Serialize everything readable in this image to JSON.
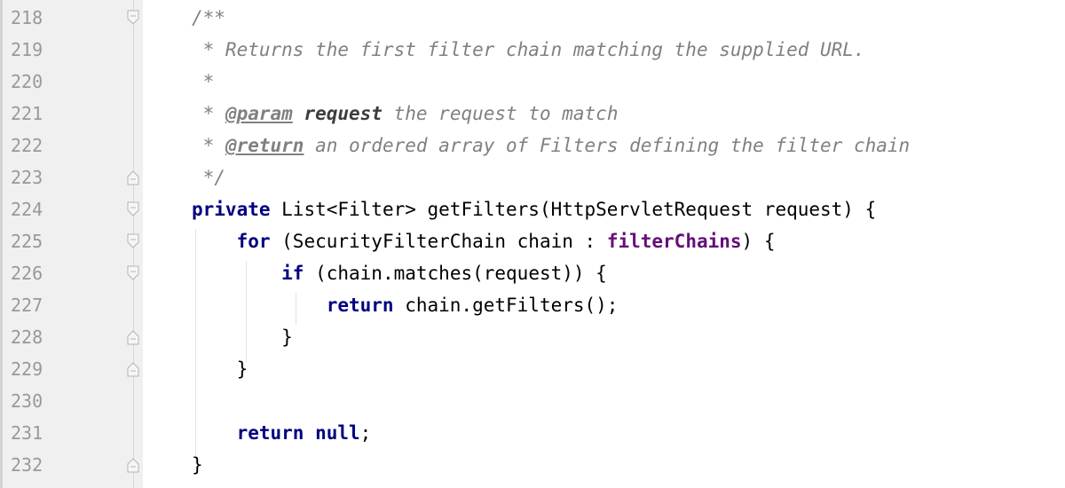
{
  "lines": [
    {
      "num": "218",
      "t1": "/**"
    },
    {
      "num": "219",
      "t1": " * Returns the first filter chain matching the supplied URL."
    },
    {
      "num": "220",
      "t1": " *"
    },
    {
      "num": "221",
      "t1": " * ",
      "t2": "@param",
      "t3": " ",
      "t4": "request",
      "t5": " the request to match"
    },
    {
      "num": "222",
      "t1": " * ",
      "t2": "@return",
      "t3": " an ordered array of Filters defining the filter chain"
    },
    {
      "num": "223",
      "t1": " */"
    },
    {
      "num": "224",
      "t1": "private",
      "t2": " List<Filter> getFilters(HttpServletRequest request) {"
    },
    {
      "num": "225",
      "t1": "    ",
      "t2": "for",
      "t3": " (SecurityFilterChain chain : ",
      "t4": "filterChains",
      "t5": ") {"
    },
    {
      "num": "226",
      "t1": "        ",
      "t2": "if",
      "t3": " (chain.matches(request)) {"
    },
    {
      "num": "227",
      "t1": "            ",
      "t2": "return",
      "t3": " chain.getFilters();"
    },
    {
      "num": "228",
      "t1": "        }"
    },
    {
      "num": "229",
      "t1": "    }"
    },
    {
      "num": "230"
    },
    {
      "num": "231",
      "t1": "    ",
      "t2": "return",
      "t3": " ",
      "t4": "null",
      "t5": ";"
    },
    {
      "num": "232",
      "t1": "}"
    }
  ]
}
